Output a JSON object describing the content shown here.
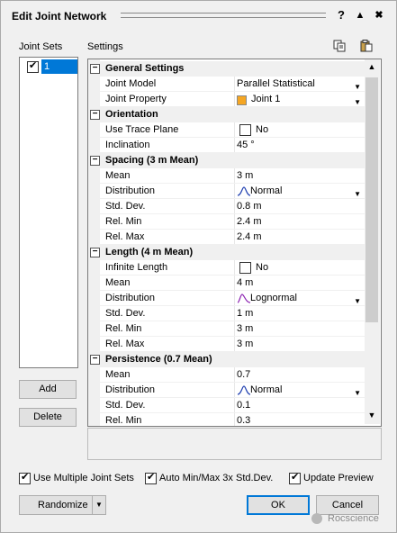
{
  "window": {
    "title": "Edit Joint Network",
    "help": "?",
    "collapse": "▲",
    "close": "✖"
  },
  "joint_sets": {
    "header": "Joint Sets",
    "items": [
      {
        "label": "1",
        "checked": true
      }
    ]
  },
  "settings_header": "Settings",
  "buttons": {
    "add": "Add",
    "delete": "Delete",
    "randomize": "Randomize",
    "ok": "OK",
    "cancel": "Cancel"
  },
  "grid": {
    "categories": {
      "general": "General Settings",
      "orientation": "Orientation",
      "spacing": "Spacing   (3 m  Mean)",
      "length": "Length   (4 m  Mean)",
      "persistence": "Persistence   (0.7  Mean)"
    },
    "rows": {
      "joint_model": {
        "name": "Joint Model",
        "value": "Parallel Statistical"
      },
      "joint_property": {
        "name": "Joint Property",
        "value": "Joint 1"
      },
      "use_trace_plane": {
        "name": "Use Trace Plane",
        "value": "No"
      },
      "inclination": {
        "name": "Inclination",
        "value": "45 °"
      },
      "sp_mean": {
        "name": "Mean",
        "value": "3 m"
      },
      "sp_dist": {
        "name": "Distribution",
        "value": "Normal"
      },
      "sp_std": {
        "name": "Std. Dev.",
        "value": "0.8 m"
      },
      "sp_min": {
        "name": "Rel. Min",
        "value": "2.4 m"
      },
      "sp_max": {
        "name": "Rel. Max",
        "value": "2.4 m"
      },
      "le_inf": {
        "name": "Infinite Length",
        "value": "No"
      },
      "le_mean": {
        "name": "Mean",
        "value": "4 m"
      },
      "le_dist": {
        "name": "Distribution",
        "value": "Lognormal"
      },
      "le_std": {
        "name": "Std. Dev.",
        "value": "1 m"
      },
      "le_min": {
        "name": "Rel. Min",
        "value": "3 m"
      },
      "le_max": {
        "name": "Rel. Max",
        "value": "3 m"
      },
      "pe_mean": {
        "name": "Mean",
        "value": "0.7"
      },
      "pe_dist": {
        "name": "Distribution",
        "value": "Normal"
      },
      "pe_std": {
        "name": "Std. Dev.",
        "value": "0.1"
      },
      "pe_min": {
        "name": "Rel. Min",
        "value": "0.3"
      }
    }
  },
  "options": {
    "multiple_sets": {
      "label": "Use Multiple Joint Sets",
      "checked": true
    },
    "auto_minmax": {
      "label": "Auto Min/Max 3x Std.Dev.",
      "checked": true
    },
    "update_preview": {
      "label": "Update Preview",
      "checked": true
    }
  },
  "watermark": "Rocscience",
  "colors": {
    "selection": "#0078d7",
    "joint_swatch": "#f5a623",
    "dist_curve": "#1f3fb0",
    "lognormal_curve": "#8a1fb0"
  }
}
